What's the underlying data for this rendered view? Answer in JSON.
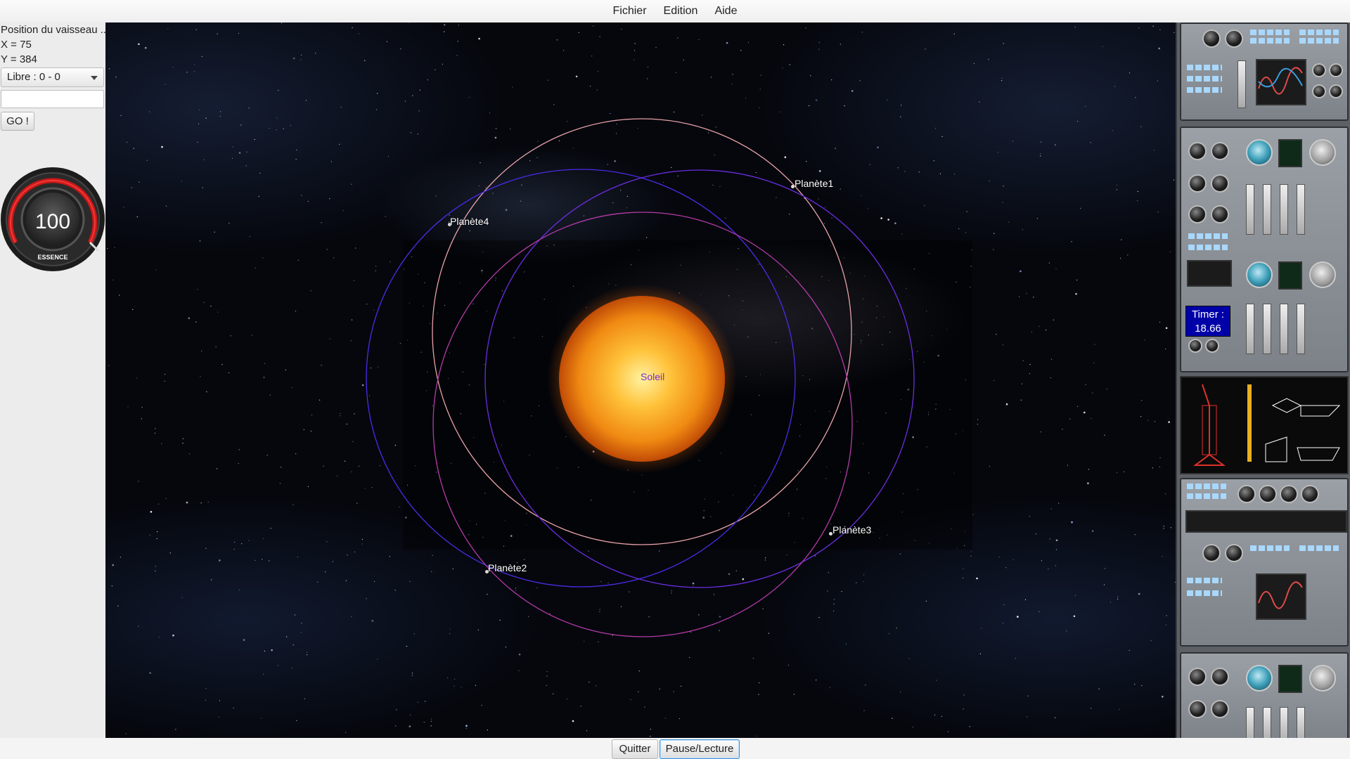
{
  "menu": {
    "items": [
      "Fichier",
      "Edition",
      "Aide"
    ]
  },
  "left_panel": {
    "position_title": "Position du vaisseau ...",
    "x_text": "X = 75",
    "y_text": "Y = 384",
    "mode_select": "Libre : 0 - 0",
    "coord_input_value": "",
    "go_label": "GO !",
    "fuel": {
      "value": "100",
      "label": "ESSENCE",
      "level": 1.0
    }
  },
  "space": {
    "sun_label": "Soleil",
    "planets": [
      "Planète1",
      "Planète2",
      "Planète3",
      "Planète4"
    ],
    "colors": {
      "sun_label": "#7a2bd6",
      "orbit_pink": "#e6a2a8",
      "orbit_blue": "#4b2be8",
      "orbit_violet": "#6b2de0",
      "orbit_magenta": "#b53aa8"
    }
  },
  "right_panel": {
    "timer_label": "Timer :",
    "timer_value": "18.66",
    "timer_bg": "#0000a8"
  },
  "bottom": {
    "quit_label": "Quitter",
    "pause_label": "Pause/Lecture"
  }
}
